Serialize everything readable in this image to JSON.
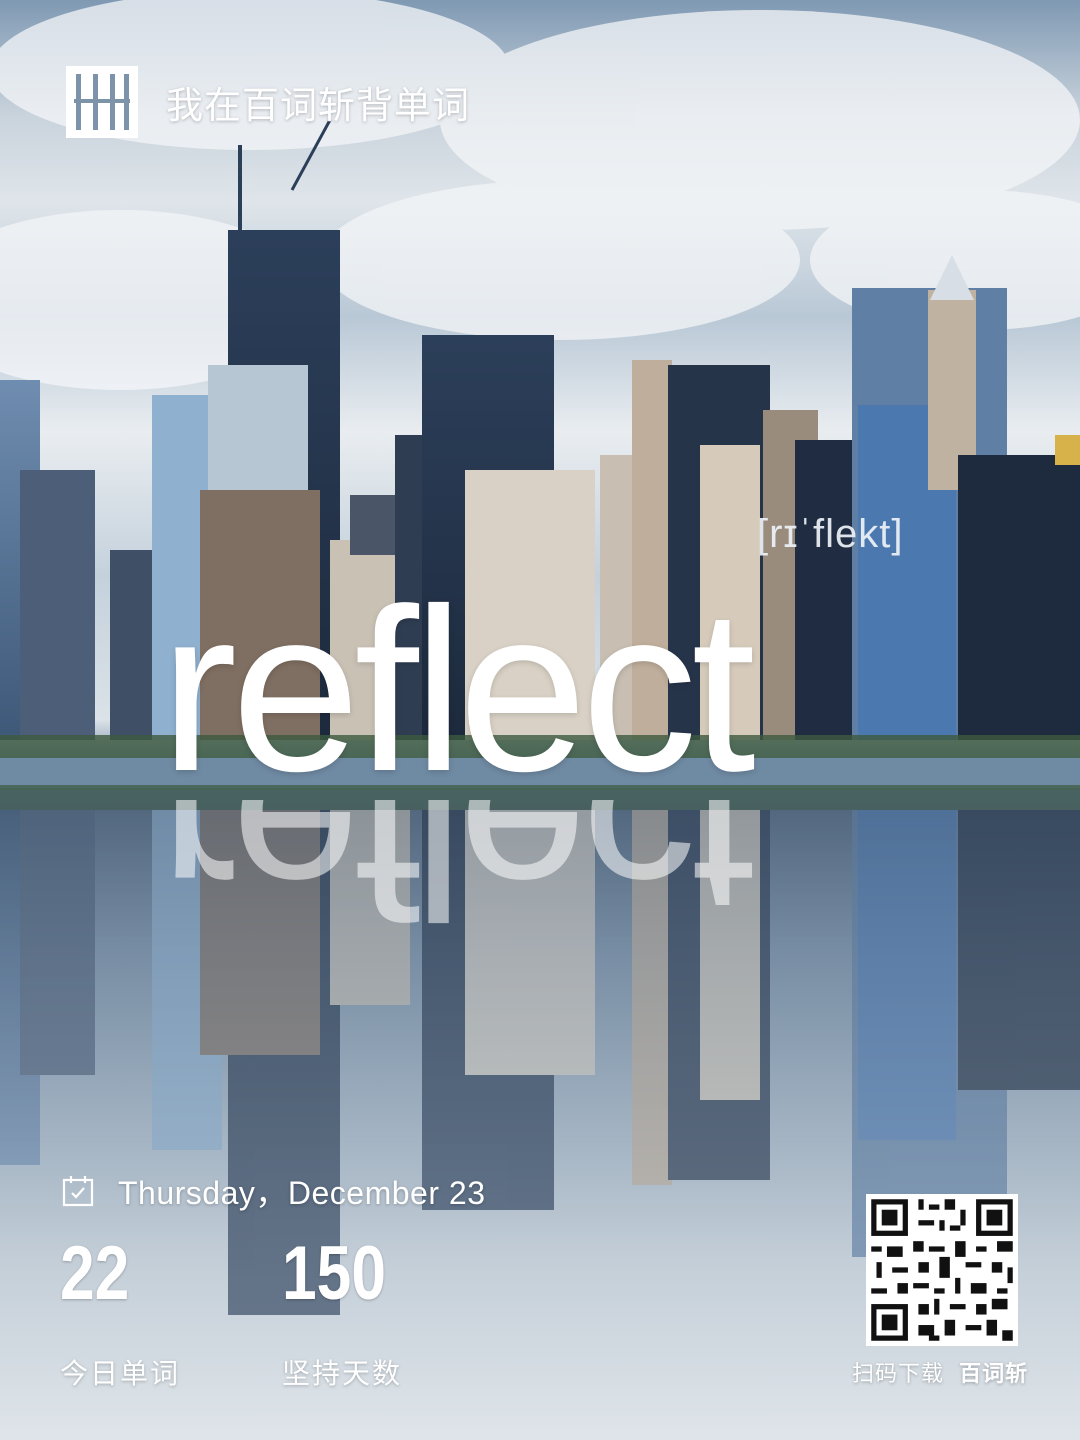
{
  "brand": {
    "logo_icon": "baicizhan-logo-icon",
    "tagline": "我在百词斩背单词"
  },
  "word": {
    "text": "reflect",
    "phonetic": "[rɪˈflekt]"
  },
  "date": {
    "icon": "calendar-check-icon",
    "text": "Thursday，December 23"
  },
  "stats": [
    {
      "value": "22",
      "label": "今日单词"
    },
    {
      "value": "150",
      "label": "坚持天数"
    }
  ],
  "qr": {
    "icon": "qr-code-icon",
    "caption_prefix": "扫码下载",
    "caption_brand": "百词斩"
  },
  "colors": {
    "text": "#ffffff",
    "sky": "#dfe5ea",
    "water": "#52677c"
  }
}
